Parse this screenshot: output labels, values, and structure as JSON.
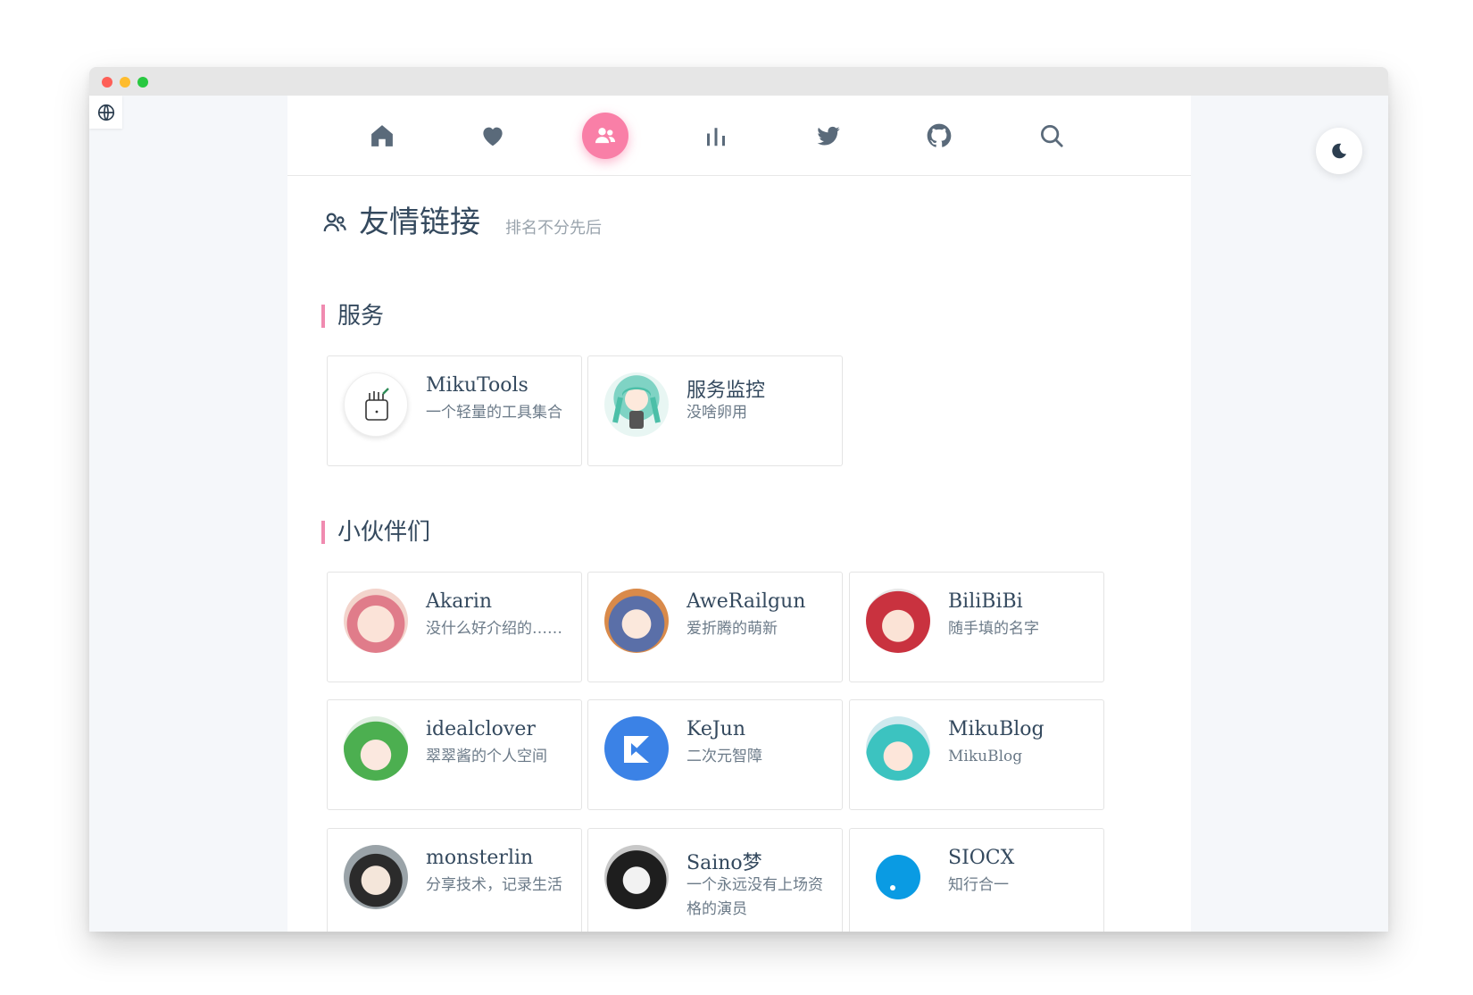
{
  "nav": {
    "icons": [
      "home-icon",
      "heart-icon",
      "friends-icon",
      "stats-icon",
      "twitter-icon",
      "github-icon",
      "search-icon"
    ],
    "active": "friends-icon",
    "accent": "#f97fa7"
  },
  "page": {
    "title": "友情链接",
    "subtitle": "排名不分先后"
  },
  "sections": [
    {
      "title": "服务",
      "links": [
        {
          "name": "MikuTools",
          "desc": "一个轻量的工具集合"
        },
        {
          "name": "服务监控",
          "desc": "没啥卵用"
        }
      ]
    },
    {
      "title": "小伙伴们",
      "links": [
        {
          "name": "Akarin",
          "desc": "没什么好介绍的……"
        },
        {
          "name": "AweRailgun",
          "desc": "爱折腾的萌新"
        },
        {
          "name": "BiliBiBi",
          "desc": "随手填的名字"
        },
        {
          "name": "idealclover",
          "desc": "翠翠酱的个人空间"
        },
        {
          "name": "KeJun",
          "desc": "二次元智障"
        },
        {
          "name": "MikuBlog",
          "desc": "MikuBlog"
        },
        {
          "name": "monsterlin",
          "desc": "分享技术，记录生活"
        },
        {
          "name": "Saino梦",
          "desc": "一个永远没有上场资格的演员"
        },
        {
          "name": "SIOCX",
          "desc": "知行合一"
        }
      ]
    }
  ],
  "colors": {
    "section_bar": "#f08bb0",
    "text": "#34495e"
  }
}
